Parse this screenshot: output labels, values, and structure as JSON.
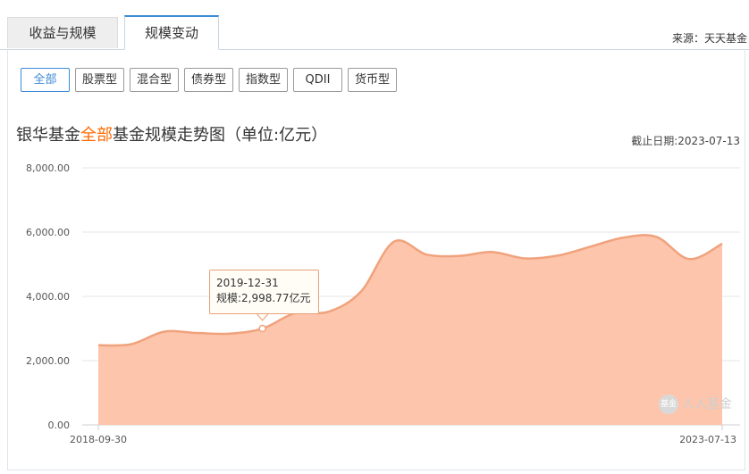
{
  "tabs": [
    {
      "label": "收益与规模",
      "active": false
    },
    {
      "label": "规模变动",
      "active": true
    }
  ],
  "source": "来源：天天基金",
  "filters": [
    {
      "label": "全部",
      "active": true
    },
    {
      "label": "股票型",
      "active": false
    },
    {
      "label": "混合型",
      "active": false
    },
    {
      "label": "债券型",
      "active": false
    },
    {
      "label": "指数型",
      "active": false
    },
    {
      "label": "QDII",
      "active": false
    },
    {
      "label": "货币型",
      "active": false
    }
  ],
  "title": {
    "prefix": "银华基金",
    "highlight": "全部",
    "suffix": "基金规模走势图（单位:亿元）"
  },
  "deadline": "截止日期:2023-07-13",
  "tooltip": {
    "date": "2019-12-31",
    "value": "规模:2,998.77亿元"
  },
  "watermark": "人人基金",
  "colors": {
    "accent": "#3d8ad6",
    "highlight": "#ff6a00",
    "series_line": "#f0a27c",
    "series_fill": "#fdc5ac"
  },
  "chart_data": {
    "type": "area",
    "title": "银华基金全部基金规模走势图（单位:亿元）",
    "x_tick_labels": [
      "2018-09-30",
      "2023-07-13"
    ],
    "y_ticks": [
      0,
      2000,
      4000,
      6000,
      8000
    ],
    "y_tick_labels": [
      "0.00",
      "2,000.00",
      "4,000.00",
      "6,000.00",
      "8,000.00"
    ],
    "ylim": [
      0,
      8000
    ],
    "grid": true,
    "x": [
      "2018-09-30",
      "2018-12-31",
      "2019-03-31",
      "2019-06-30",
      "2019-09-30",
      "2019-12-31",
      "2020-03-31",
      "2020-06-30",
      "2020-09-30",
      "2020-12-31",
      "2021-03-31",
      "2021-06-30",
      "2021-09-30",
      "2021-12-31",
      "2022-03-31",
      "2022-06-30",
      "2022-09-30",
      "2022-12-31",
      "2023-03-31",
      "2023-07-13"
    ],
    "values": [
      2480,
      2510,
      2900,
      2860,
      2840,
      2998.77,
      3480,
      3520,
      4150,
      5700,
      5300,
      5260,
      5380,
      5180,
      5270,
      5550,
      5830,
      5850,
      5160,
      5640
    ],
    "highlight_index": 5
  }
}
